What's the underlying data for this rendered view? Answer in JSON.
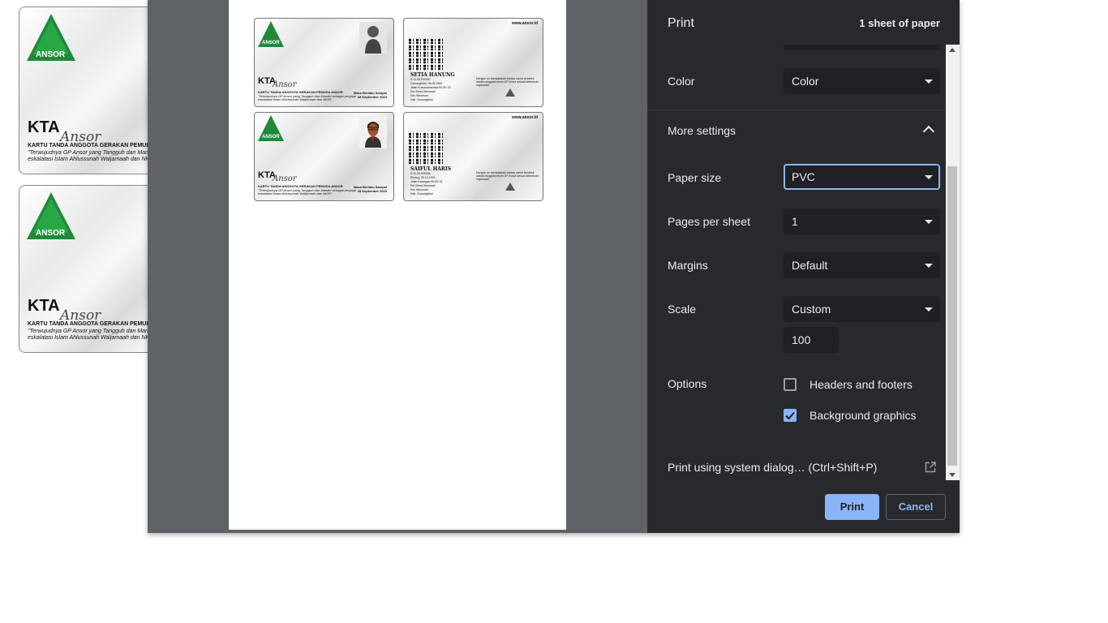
{
  "background_cards": {
    "kta": "KTA",
    "ansor": "Ansor",
    "logo_text": "ANSOR",
    "line1": "KARTU TANDA ANGGOTA GERAKAN PEMUD",
    "line2": "\"Terwujudnya GP Ansor yang Tangguh dan Mandiri",
    "line3": "eskalatasi Islam Ahlussunah Waljamaah dan NKRI\""
  },
  "preview": {
    "front": {
      "logo_text": "ANSOR",
      "kta": "KTA",
      "ansor": "Ansor",
      "line1": "KARTU TANDA ANGGOTA GERAKAN PEMUDA ANSOR",
      "line2": "\"Terwujudnya GP Ansor yang Tangguh dan Mandiri sebagai penjaga",
      "line3": "eskalatasi Islam Ahlussunah Waljamaah dan NKRI\"",
      "validity_label": "Masa Berlaku Sampai",
      "validity_date": "28 September 2023"
    },
    "back": {
      "url": "www.ansor.id",
      "cards": [
        {
          "name": "SETIA HANUNG",
          "details": [
            "S.12.05.000087",
            "Gunungkidul, 06.05.1990",
            "Jalan Kusumawardani BLOK 03",
            "Kel./Desa Wonosari",
            "Kec Wonosari",
            "Kab. Gunungkidul"
          ]
        },
        {
          "name": "SAIFUL HARIS",
          "details": [
            "S.12.05.000086",
            "Rihang, 05.10.1992",
            "Jalan Karangan BLOK 01",
            "Kel./Desa Wonosari",
            "Kec Wonosari",
            "Kab. Gunungkidul"
          ]
        }
      ],
      "statement": "Dengan ini menyatakan bahwa nama tersebut adalah anggota resmi GP Ansor sesuai ketentuan organisasi."
    }
  },
  "panel": {
    "title": "Print",
    "sheets": "1 sheet of paper",
    "color_label": "Color",
    "color_value": "Color",
    "more_settings": "More settings",
    "paper_size_label": "Paper size",
    "paper_size_value": "PVC",
    "pages_per_sheet_label": "Pages per sheet",
    "pages_per_sheet_value": "1",
    "margins_label": "Margins",
    "margins_value": "Default",
    "scale_label": "Scale",
    "scale_value": "Custom",
    "scale_input": "100",
    "options_label": "Options",
    "headers_footers": "Headers and footers",
    "headers_footers_checked": false,
    "background_graphics": "Background graphics",
    "background_graphics_checked": true,
    "system_dialog": "Print using system dialog… (Ctrl+Shift+P)",
    "print_button": "Print",
    "cancel_button": "Cancel"
  },
  "colors": {
    "panel_bg": "#292a2d",
    "accent": "#8ab4f8",
    "dialog_bg": "#5f6368",
    "logo_green": "#1e8a3a"
  }
}
